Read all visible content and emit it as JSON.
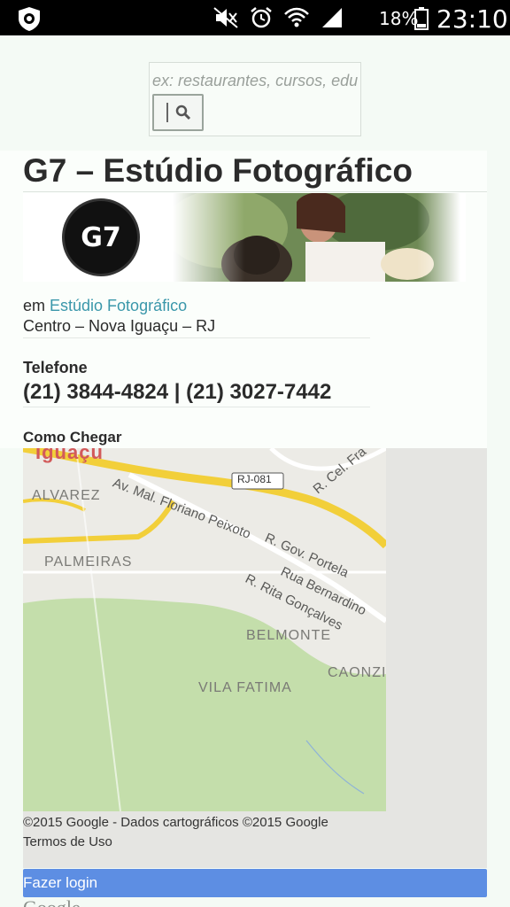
{
  "status_bar": {
    "battery_percent": "18%",
    "time": "23:10"
  },
  "search": {
    "placeholder": "ex: restaurantes, cursos, edu"
  },
  "listing": {
    "title": "G7 – Estúdio Fotográfico",
    "logo_text": "G7",
    "category_prefix": "em ",
    "category": "Estúdio Fotográfico",
    "address": "Centro – Nova Iguaçu – RJ",
    "phone_heading": "Telefone",
    "phones": "(21) 3844-4824 | (21) 3027-7442",
    "directions_heading": "Como Chegar"
  },
  "map": {
    "labels": {
      "iguacu": "Iguaçu",
      "alvarez": "ALVAREZ",
      "palmeiras": "PALMEIRAS",
      "belmonte": "BELMONTE",
      "caonze": "CAONZI",
      "vila_fatima": "VILA FATIMA",
      "rj081": "RJ-081",
      "av_floriano": "Av. Mal. Floriano Peixoto",
      "gov_portela": "R. Gov. Portela",
      "rua_bernardino": "Rua Bernardino",
      "rita_goncalves": "R. Rita Gonçalves",
      "cel_fra": "R. Cel. Fra"
    },
    "credit": "©2015 Google - Dados cartográficos ©2015 Google",
    "terms": "Termos de Uso"
  },
  "footer": {
    "login_label": "Fazer login",
    "google_partial": "Google"
  },
  "colors": {
    "link": "#3a97aa",
    "login_bar": "#5d8ee3",
    "road_yellow": "#f2cf3a",
    "park_green": "#c4deab"
  }
}
